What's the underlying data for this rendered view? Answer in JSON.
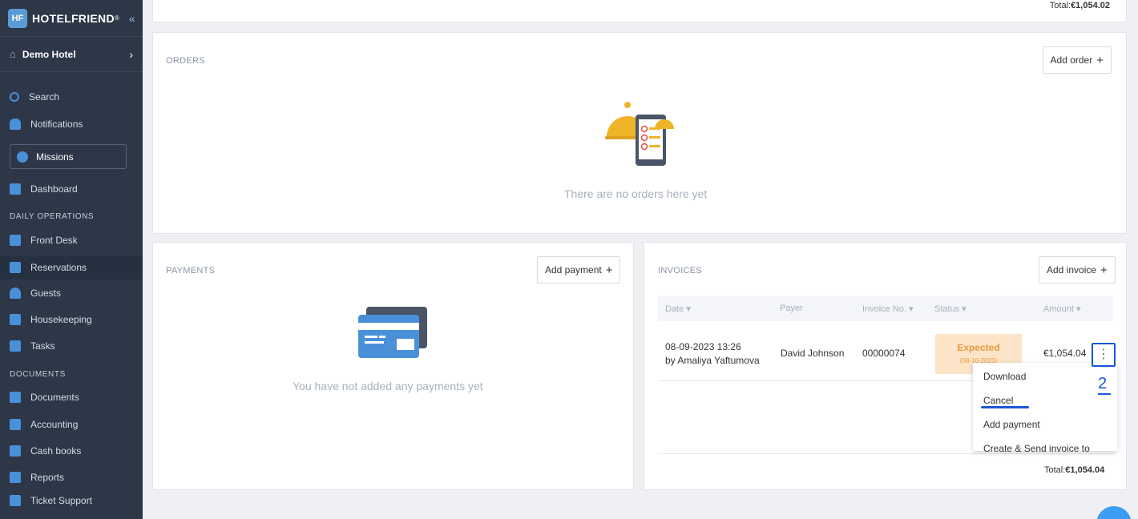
{
  "sidebar": {
    "brand": "HOTELFRIEND",
    "brand_mark": "HF",
    "hotel_name": "Demo Hotel",
    "search": "Search",
    "notifications": "Notifications",
    "missions": "Missions",
    "dashboard": "Dashboard",
    "section_daily": "DAILY OPERATIONS",
    "front_desk": "Front Desk",
    "reservations": "Reservations",
    "guests": "Guests",
    "housekeeping": "Housekeeping",
    "tasks": "Tasks",
    "section_documents": "DOCUMENTS",
    "documents": "Documents",
    "accounting": "Accounting",
    "cash_books": "Cash books",
    "reports": "Reports",
    "ticket_support": "Ticket Support"
  },
  "top_total": {
    "label": "Total:",
    "value": "€1,054.02"
  },
  "orders": {
    "title": "ORDERS",
    "add_label": "Add order",
    "empty": "There are no orders here yet"
  },
  "payments": {
    "title": "PAYMENTS",
    "add_label": "Add payment",
    "empty": "You have not added any payments yet"
  },
  "invoices": {
    "title": "INVOICES",
    "add_label": "Add invoice",
    "columns": {
      "date": "Date",
      "payer": "Payer",
      "invoice_no": "Invoice No.",
      "status": "Status",
      "amount": "Amount"
    },
    "row": {
      "date": "08-09-2023 13:26",
      "by": "by Amaliya Yaftumova",
      "payer": "David Johnson",
      "invoice_no": "00000074",
      "status": "Expected",
      "status_date": "(08-10-2023)",
      "amount": "€1,054.04"
    },
    "menu": {
      "download": "Download",
      "cancel": "Cancel",
      "add_payment": "Add payment",
      "create_send": "Create & Send invoice to"
    },
    "total": {
      "label": "Total:",
      "value": "€1,054.04"
    }
  },
  "annotation": "2",
  "colors": {
    "sidebar_bg": "#2d3748",
    "accent": "#1a56d6",
    "status_bg": "#fce4c8",
    "status_text": "#e89a3a"
  }
}
